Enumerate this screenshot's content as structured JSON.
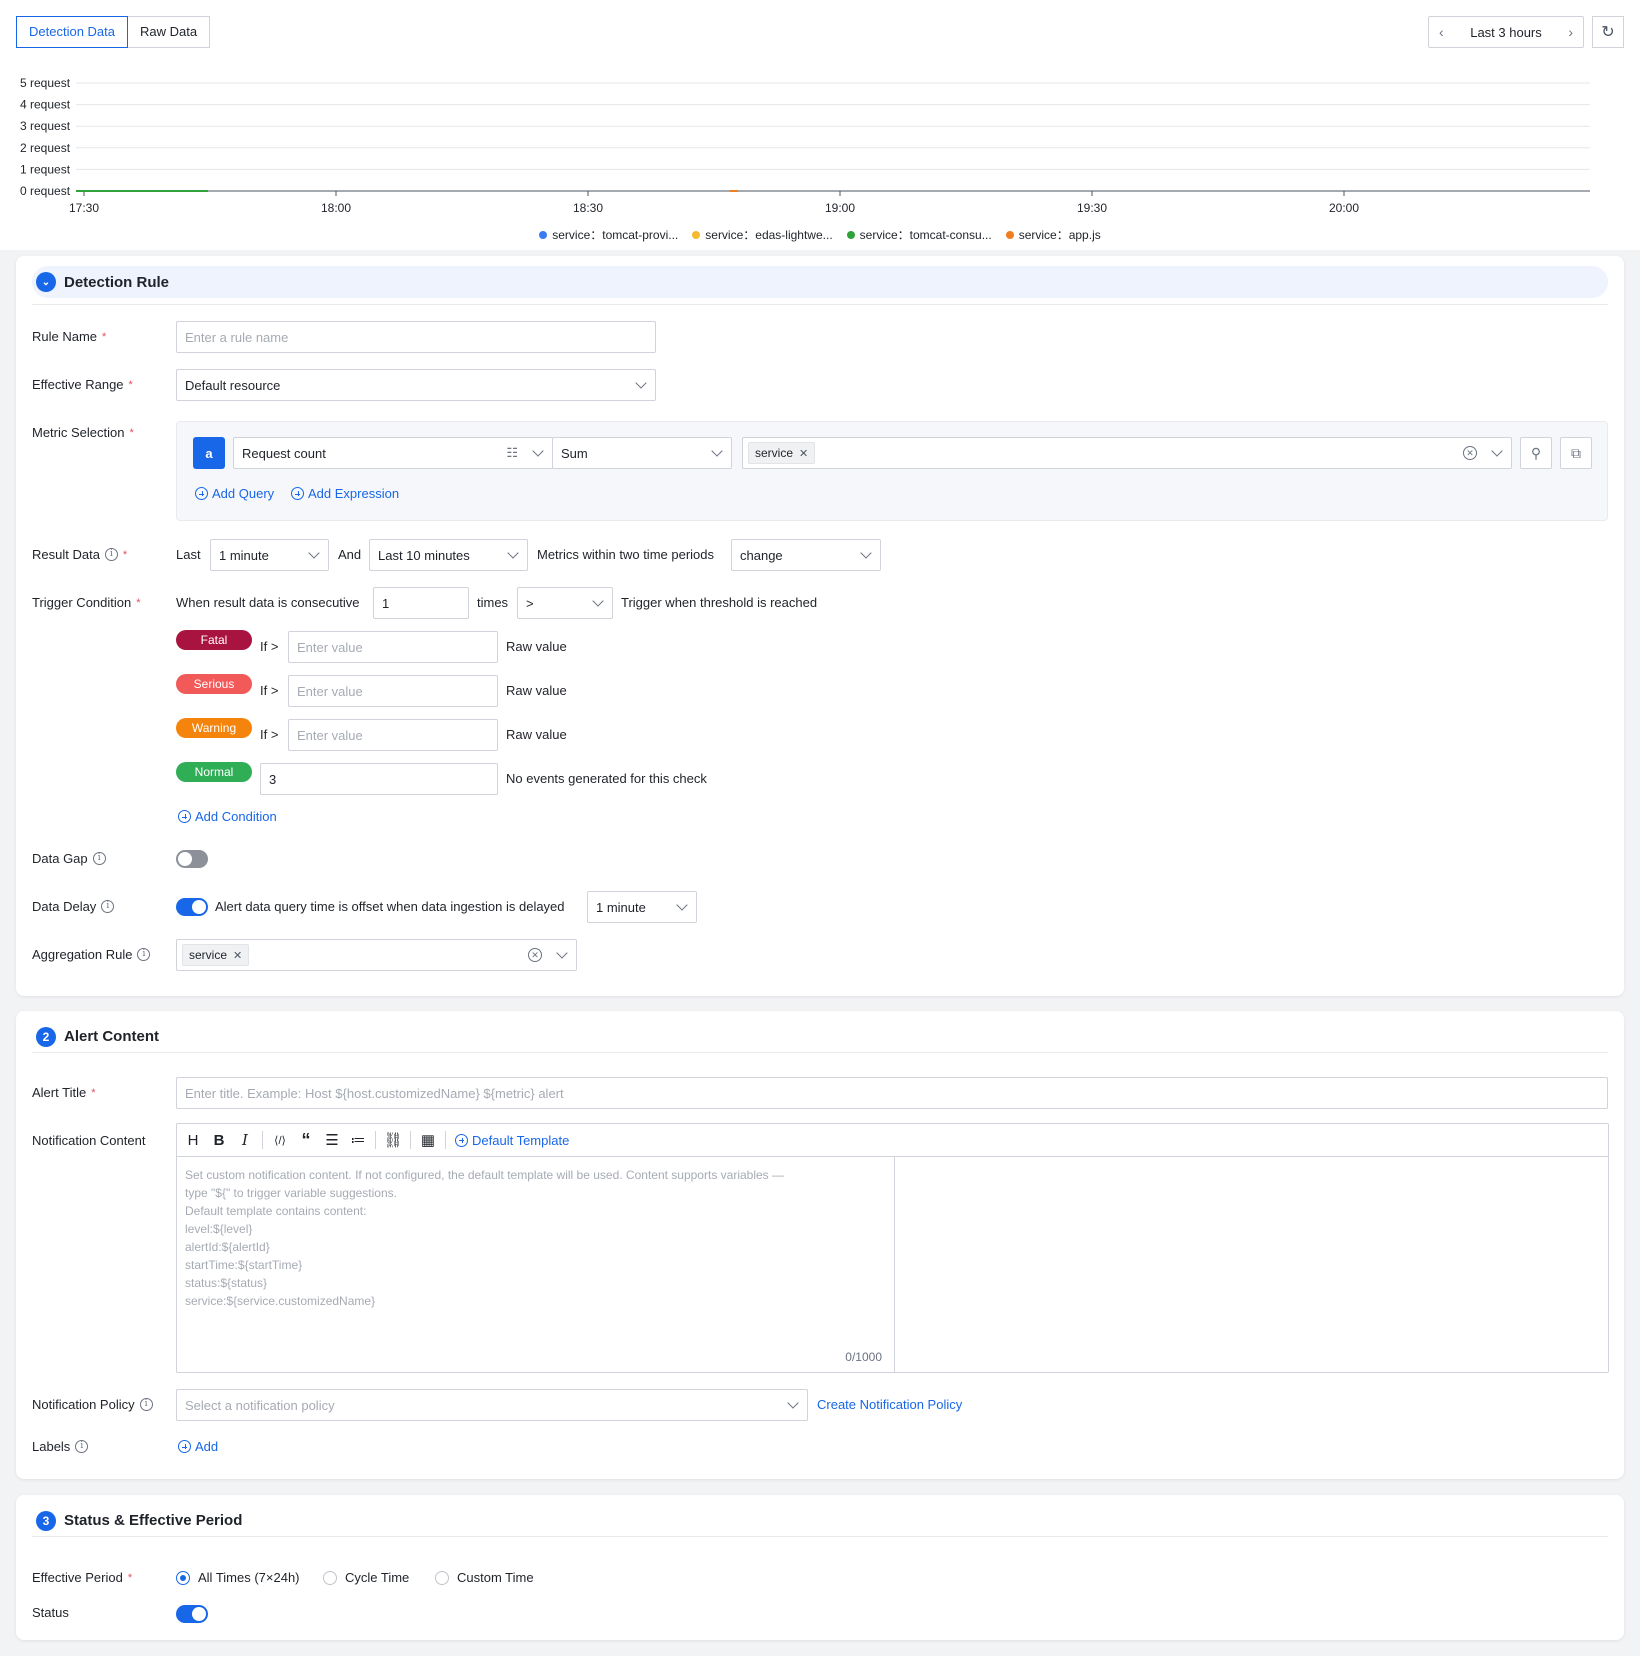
{
  "tabs": {
    "detection": "Detection Data",
    "raw": "Raw Data"
  },
  "time_range": {
    "label": "Last 3 hours"
  },
  "chart_data": {
    "type": "line",
    "x": [
      "17:30",
      "18:00",
      "18:30",
      "19:00",
      "19:30",
      "20:00"
    ],
    "y_ticks": [
      "0 request",
      "1 request",
      "2 request",
      "3 request",
      "4 request",
      "5 request"
    ],
    "ylim": [
      0,
      5
    ],
    "grid": true,
    "legend_position": "bottom",
    "series": [
      {
        "name": "service：tomcat-provi...",
        "color": "#3a7bf0",
        "values": []
      },
      {
        "name": "service：edas-lightwe...",
        "color": "#f5b82e",
        "values": []
      },
      {
        "name": "service：tomcat-consu...",
        "color": "#2ea33a",
        "values": [
          0,
          0,
          0,
          0,
          0,
          0,
          0
        ]
      },
      {
        "name": "service：app.js",
        "color": "#f07d1e",
        "values": [
          0
        ]
      }
    ]
  },
  "detection_rule": {
    "title": "Detection Rule",
    "rule_name": {
      "label": "Rule Name",
      "placeholder": "Enter a rule name"
    },
    "effective_range": {
      "label": "Effective Range",
      "value": "Default resource"
    },
    "metric_selection": {
      "label": "Metric Selection",
      "query_letter": "a",
      "metric": "Request count",
      "aggregation": "Sum",
      "group_tag": "service",
      "add_query": "Add Query",
      "add_expression": "Add Expression"
    },
    "result_data": {
      "label": "Result Data",
      "last": "Last",
      "window": "1 minute",
      "and": "And",
      "compare": "Last 10 minutes",
      "metrics_text": "Metrics within two time periods",
      "mode": "change"
    },
    "trigger_condition": {
      "label": "Trigger Condition",
      "prefix": "When result data is consecutive",
      "times_value": "1",
      "times": "times",
      "operator": ">",
      "suffix": "Trigger when threshold is reached",
      "levels": [
        {
          "name": "Fatal",
          "color": "#a8133f",
          "if": "If >",
          "placeholder": "Enter value",
          "note": "Raw value"
        },
        {
          "name": "Serious",
          "color": "#f25a5a",
          "if": "If >",
          "placeholder": "Enter value",
          "note": "Raw value"
        },
        {
          "name": "Warning",
          "color": "#f5840c",
          "if": "If >",
          "placeholder": "Enter value",
          "note": "Raw value"
        },
        {
          "name": "Normal",
          "color": "#2fae56",
          "value": "3",
          "note": "No events generated for this check"
        }
      ],
      "add_condition": "Add Condition"
    },
    "data_gap": {
      "label": "Data Gap",
      "enabled": false
    },
    "data_delay": {
      "label": "Data Delay",
      "enabled": true,
      "text": "Alert data query time is offset when data ingestion is delayed",
      "value": "1 minute"
    },
    "aggregation_rule": {
      "label": "Aggregation Rule",
      "tag": "service"
    }
  },
  "alert_content": {
    "step": "2",
    "title": "Alert Content",
    "alert_title": {
      "label": "Alert Title",
      "placeholder": "Enter title. Example: Host ${host.customizedName} ${metric} alert"
    },
    "notification_content": {
      "label": "Notification Content",
      "default_template": "Default Template",
      "placeholder_lines": [
        "Set custom notification content. If not configured, the default template will be used. Content supports variables —",
        "type \"${\" to trigger variable suggestions.",
        "Default template contains content:",
        "level:${level}",
        "alertId:${alertId}",
        "startTime:${startTime}",
        "status:${status}",
        "service:${service.customizedName}"
      ],
      "counter": "0/1000"
    },
    "notification_policy": {
      "label": "Notification Policy",
      "placeholder": "Select a notification policy",
      "create": "Create Notification Policy"
    },
    "labels": {
      "label": "Labels",
      "add": "Add"
    }
  },
  "status_period": {
    "step": "3",
    "title": "Status & Effective Period",
    "effective_period": {
      "label": "Effective Period",
      "options": [
        "All Times (7×24h)",
        "Cycle Time",
        "Custom Time"
      ],
      "selected": "All Times (7×24h)"
    },
    "status": {
      "label": "Status",
      "enabled": true
    }
  },
  "colors": {
    "accent": "#1867e8"
  }
}
